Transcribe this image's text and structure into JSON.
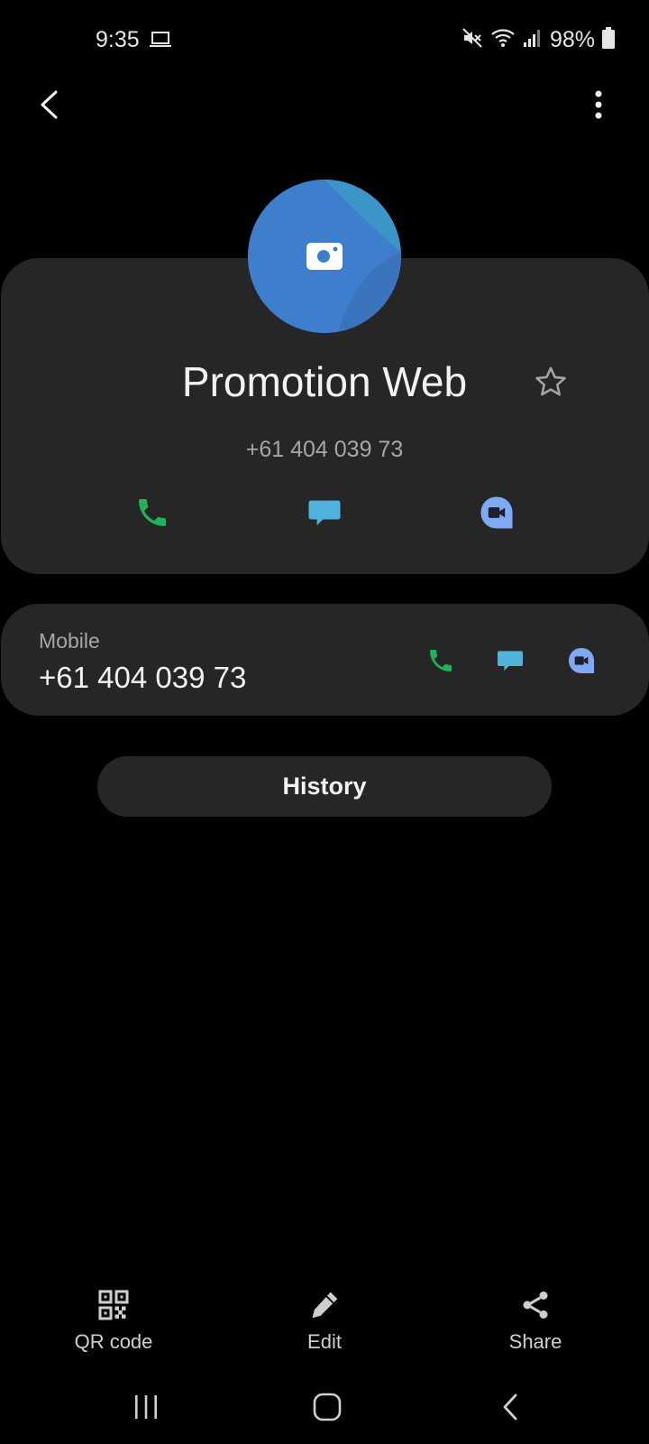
{
  "status_bar": {
    "time": "9:35",
    "battery": "98%"
  },
  "contact": {
    "name": "Promotion Web",
    "phone": "+61 404 039 73",
    "favorite": false
  },
  "mobile_row": {
    "label": "Mobile",
    "number": "+61 404 039 73"
  },
  "history": {
    "label": "History"
  },
  "bottom_actions": [
    {
      "label": "QR code",
      "icon": "qr-code-icon"
    },
    {
      "label": "Edit",
      "icon": "pencil-icon"
    },
    {
      "label": "Share",
      "icon": "share-icon"
    }
  ],
  "colors": {
    "background": "#000000",
    "card": "#262626",
    "call_green": "#1fb25a",
    "message_blue": "#4fb3de",
    "video_blue": "#7fa8f5",
    "avatar_blue": "#3d7fcd"
  }
}
